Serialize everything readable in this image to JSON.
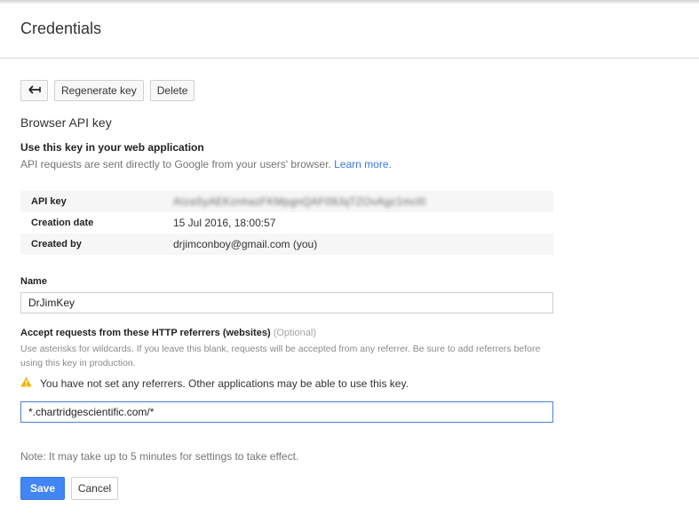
{
  "page": {
    "title": "Credentials"
  },
  "toolbar": {
    "back_icon": "arrow-left-icon",
    "regenerate_label": "Regenerate key",
    "delete_label": "Delete"
  },
  "key_section": {
    "title": "Browser API key",
    "heading": "Use this key in your web application",
    "description": "API requests are sent directly to Google from your users' browser.",
    "learn_more": "Learn more."
  },
  "details": [
    {
      "label": "API key",
      "value": "AIzaSyAEKznhazFKMpgnQAF09JqTZOvAgz1mcl0"
    },
    {
      "label": "Creation date",
      "value": "15 Jul 2016, 18:00:57"
    },
    {
      "label": "Created by",
      "value": "drjimconboy@gmail.com (you)"
    }
  ],
  "name_field": {
    "label": "Name",
    "value": "DrJimKey"
  },
  "referrers": {
    "label": "Accept requests from these HTTP referrers (websites)",
    "optional": "(Optional)",
    "help": "Use asterisks for wildcards. If you leave this blank, requests will be accepted from any referrer. Be sure to add referrers before using this key in production.",
    "warning": "You have not set any referrers. Other applications may be able to use this key.",
    "warning_icon": "warning-icon",
    "value": "*.chartridgescientific.com/*"
  },
  "note": "Note: It may take up to 5 minutes for settings to take effect.",
  "actions": {
    "save_label": "Save",
    "cancel_label": "Cancel"
  },
  "colors": {
    "primary": "#4285f4",
    "link": "#3b78e7",
    "warning": "#f4b400"
  }
}
